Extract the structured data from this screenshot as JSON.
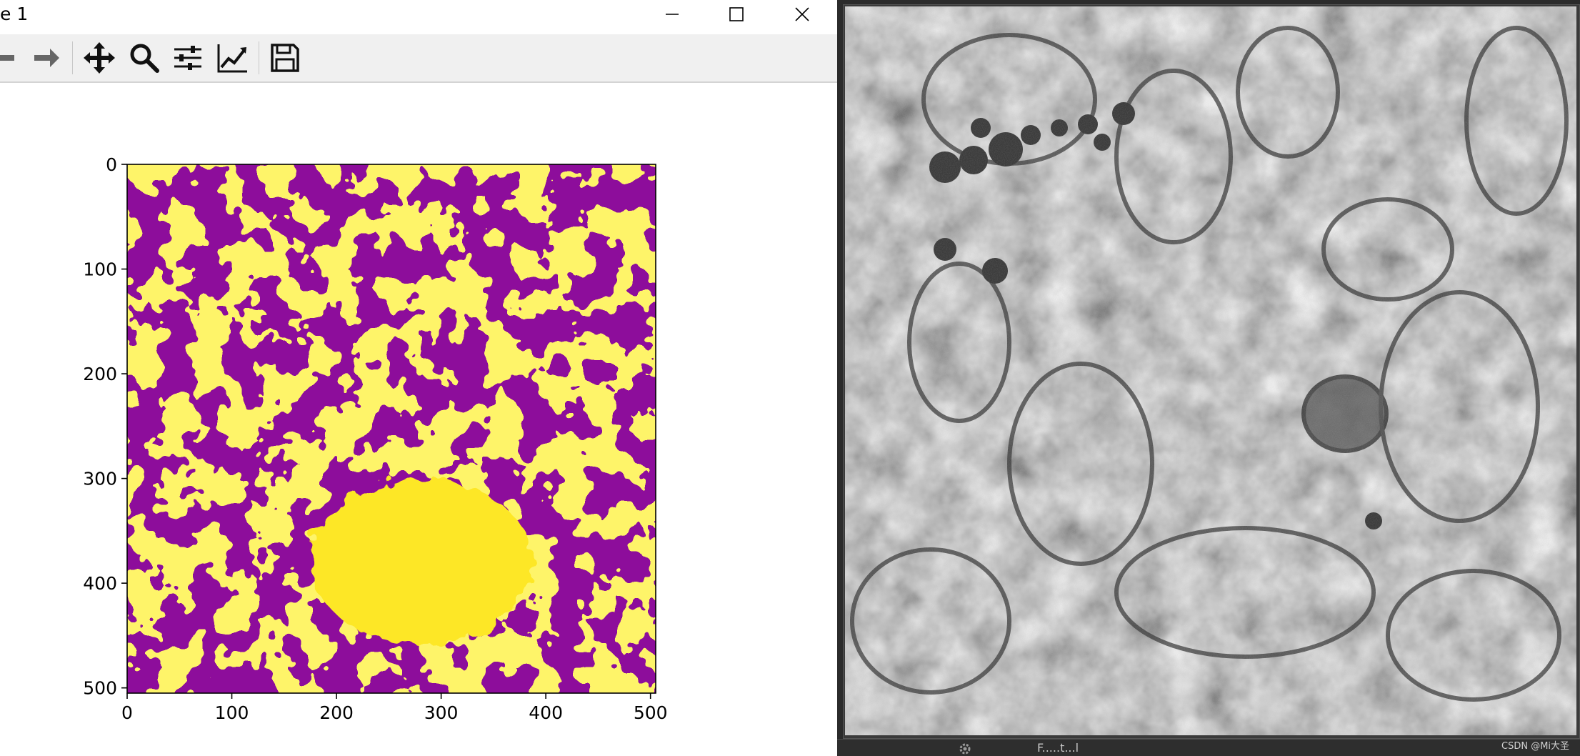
{
  "window": {
    "title": "e 1",
    "controls": {
      "minimize": "minimize-icon",
      "maximize": "maximize-icon",
      "close": "close-icon"
    }
  },
  "toolbar": {
    "buttons": [
      {
        "name": "back-button",
        "icon": "arrow-left-icon"
      },
      {
        "name": "forward-button",
        "icon": "arrow-right-icon"
      },
      {
        "name": "pan-button",
        "icon": "move-icon"
      },
      {
        "name": "zoom-button",
        "icon": "magnifier-icon"
      },
      {
        "name": "configure-subplots-button",
        "icon": "sliders-icon"
      },
      {
        "name": "edit-axes-button",
        "icon": "line-chart-icon"
      },
      {
        "name": "save-button",
        "icon": "floppy-disk-icon"
      }
    ]
  },
  "plot": {
    "image_kind": "binary segmentation mask",
    "colormap": [
      "#440154",
      "#fde725"
    ],
    "x_ticks": [
      "0",
      "100",
      "200",
      "300",
      "400",
      "500"
    ],
    "y_ticks": [
      "0",
      "100",
      "200",
      "300",
      "400",
      "500"
    ],
    "x_range": [
      0,
      505
    ],
    "y_range": [
      0,
      505
    ]
  },
  "viewer": {
    "image_kind": "grayscale electron micrograph",
    "status_text": "F.....t...l",
    "watermark": "CSDN @Mi大圣",
    "status_icon": "gear-icon"
  },
  "colors": {
    "mask_background": "#440154",
    "mask_foreground": "#fde725",
    "viewer_background": "#2b2b2b",
    "toolbar_background": "#f0f0f0"
  }
}
